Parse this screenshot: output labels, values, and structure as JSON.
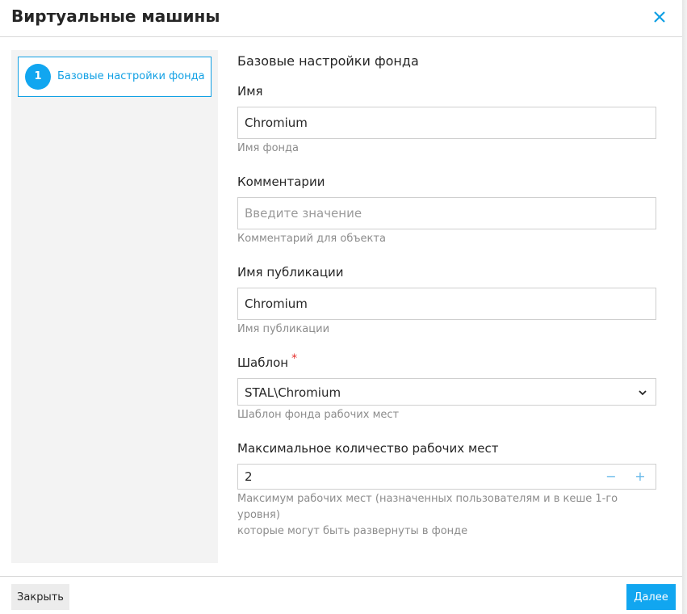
{
  "header": {
    "title": "Виртуальные машины",
    "close_icon": "close-icon"
  },
  "sidebar": {
    "steps": [
      {
        "number": "1",
        "label": "Базовые настройки фонда",
        "active": true
      }
    ]
  },
  "form": {
    "section_title": "Базовые настройки фонда",
    "name": {
      "label": "Имя",
      "value": "Chromium",
      "hint": "Имя фонда"
    },
    "comment": {
      "label": "Комментарии",
      "value": "",
      "placeholder": "Введите значение",
      "hint": "Комментарий для объекта"
    },
    "publication": {
      "label": "Имя публикации",
      "value": "Chromium",
      "hint": "Имя публикации"
    },
    "template": {
      "label": "Шаблон",
      "required_mark": "*",
      "value": "STAL\\Chromium",
      "hint": "Шаблон фонда рабочих мест"
    },
    "max_seats": {
      "label": "Максимальное количество рабочих мест",
      "value": "2",
      "decrement": "−",
      "increment": "+",
      "hint_line1": "Максимум рабочих мест (назначенных пользователям и в кеше 1-го уровня)",
      "hint_line2": "которые могут быть развернуты в фонде"
    }
  },
  "footer": {
    "close_label": "Закрыть",
    "next_label": "Далее"
  },
  "colors": {
    "accent": "#11a6f0",
    "required": "#e5312d"
  }
}
